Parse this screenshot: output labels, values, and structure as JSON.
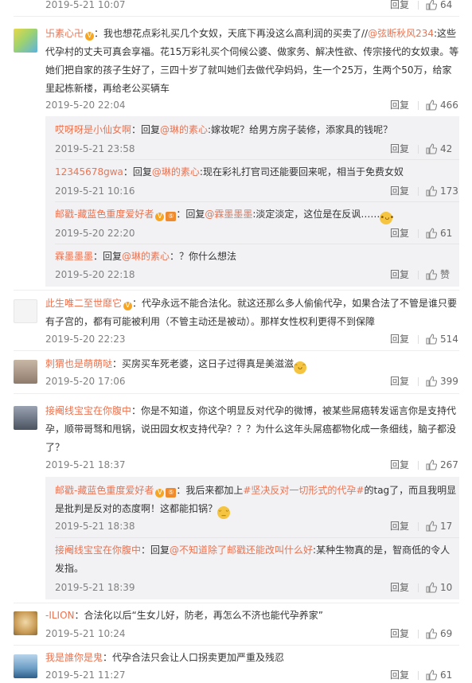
{
  "top": {
    "date": "2019-5-21 10:07",
    "reply": "回复",
    "likes": "64"
  },
  "comments": [
    {
      "user": "卐素心卍",
      "mention": "@弦断秋风234",
      "text1": "：我也想花点彩礼买几个女奴，天底下再没这么高利润的买卖了//",
      "text2": ":这些代孕村的丈夫可真会享福。花15万彩礼买个伺候公婆、做家务、解决性欲、传宗接代的女奴隶。等她们把自家的孩子生好了，三四十岁了就叫她们去做代孕妈妈，生一个25万，生两个50万，给家里起栋新楼，再给老公买辆车",
      "date": "2019-5-20 22:04",
      "reply": "回复",
      "likes": "466",
      "subs": [
        {
          "user": "哎呀呀是小仙女啊",
          "pre": "：回复",
          "mention": "@琳的素心",
          "text": ":嫁妆呢？给男方房子装修，添家具的钱呢？",
          "date": "2019-5-21 23:58",
          "reply": "回复",
          "likes": "42"
        },
        {
          "user": "12345678gwa",
          "pre": "：回复",
          "mention": "@琳的素心",
          "text": ":现在彩礼打官司还能要回来呢，相当于免费女奴",
          "date": "2019-5-21 10:16",
          "reply": "回复",
          "likes": "173"
        },
        {
          "user": "邮戳-藏蓝色重度爱好者",
          "pre": "：回复",
          "mention": "@霖墨墨墨",
          "text": ":淡定淡定，这位是在反讽……",
          "date": "2019-5-20 22:20",
          "reply": "回复",
          "likes": "61"
        },
        {
          "user": "霖墨墨墨",
          "pre": "：回复",
          "mention": "@琳的素心",
          "text": "：？你什么想法",
          "date": "2019-5-20 22:18",
          "reply": "回复",
          "likes": "赞"
        }
      ]
    },
    {
      "user": "此生唯二至世靡它",
      "text": "：代孕永远不能合法化。就这还那么多人偷偷代孕，如果合法了不管是谁只要有子宫的，都有可能被利用（不管主动还是被动）。那样女性权利更得不到保障",
      "date": "2019-5-20 22:23",
      "reply": "回复",
      "likes": "514"
    },
    {
      "user": "刺猬也是萌萌哒",
      "text": "：买房买车死老婆，这日子过得真是美滋滋",
      "date": "2019-5-20 17:06",
      "reply": "回复",
      "likes": "399"
    },
    {
      "user": "接阉线宝宝在你腹中",
      "text": "：你是不知道，你这个明显反对代孕的微博，被某些屌癌转发谣言你是支持代孕，顺带哥驽和甩锅，说田园女权支持代孕？？？为什么这年头屌癌都物化成一条细线，脑子都没了？",
      "date": "2019-5-21 18:37",
      "reply": "回复",
      "likes": "267",
      "subs": [
        {
          "user": "邮戳-藏蓝色重度爱好者",
          "pre": "：我后来都加上",
          "tag": "#坚决反对一切形式的代孕#",
          "text": "的tag了，而且我明显是批判是反对的态度啊！这都能扣锅？",
          "date": "2019-5-21 18:38",
          "reply": "回复",
          "likes": "17"
        },
        {
          "user": "接阉线宝宝在你腹中",
          "pre": "：回复",
          "mention": "@不知道除了邮戳还能改叫什么好",
          "text": ":某种生物真的是，智商低的令人发指。",
          "date": "2019-5-21 18:39",
          "reply": "回复",
          "likes": "10"
        }
      ]
    },
    {
      "user": "-ILION",
      "text": "：合法化以后“生女儿好，防老，再怎么不济也能代孕养家”",
      "date": "2019-5-21 10:24",
      "reply": "回复",
      "likes": "69"
    },
    {
      "user": "我是誰你是鬼",
      "text": "：代孕合法只会让人口拐卖更加严重及残忍",
      "date": "2019-5-21 11:27",
      "reply": "回复",
      "likes": "61"
    }
  ],
  "badges": {
    "v": "V",
    "lvl": "⑤"
  },
  "colors": {
    "username": "#eb7350",
    "text": "#333333",
    "meta": "#808080",
    "subbg": "#f2f2f5"
  }
}
